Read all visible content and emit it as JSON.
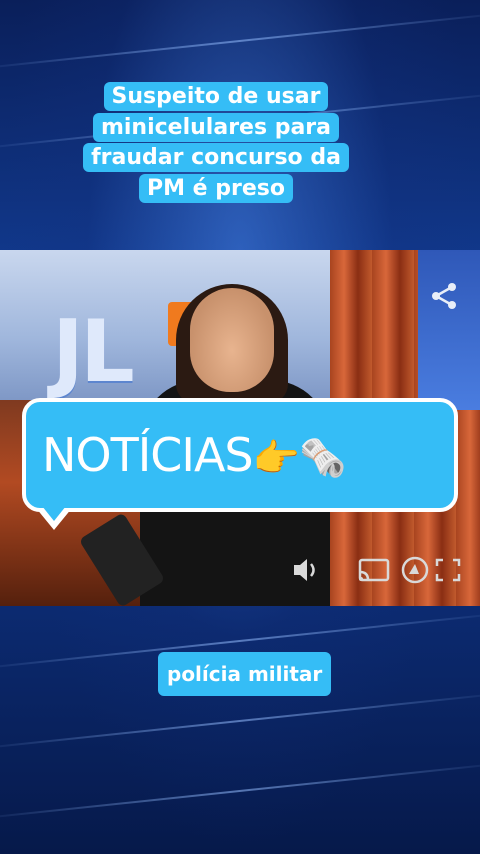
{
  "headline": {
    "lines": [
      "Suspeito de usar",
      "minicelulares para",
      "fraudar concurso da",
      "PM é preso"
    ]
  },
  "video": {
    "logo_text": "JL",
    "share_icon": "share-icon",
    "controls": [
      "volume-icon",
      "cast-icon",
      "logo-watermark-icon",
      "fullscreen-icon"
    ]
  },
  "banner": {
    "text": "NOTÍCIAS",
    "emojis": "👉🗞️"
  },
  "tag": {
    "label": "polícia militar"
  },
  "colors": {
    "accent": "#35bdf6",
    "background": "#0c2b72"
  }
}
